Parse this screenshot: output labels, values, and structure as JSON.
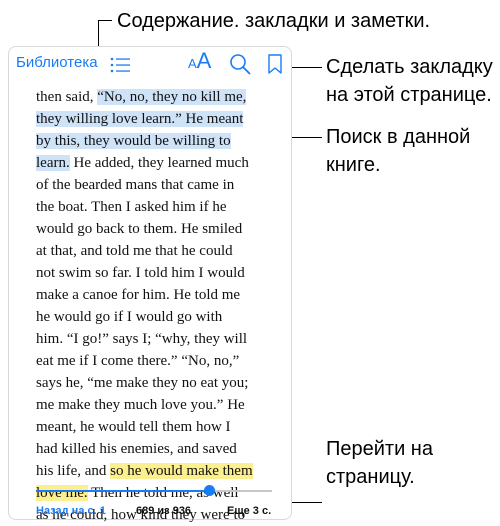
{
  "toolbar": {
    "library_label": "Библиотека",
    "font_small": "A",
    "font_large": "A",
    "toc_icon": "list-icon",
    "search_icon": "search-icon",
    "bookmark_icon": "bookmark-icon"
  },
  "callouts": {
    "toc": "Содержание. закладки и заметки.",
    "bookmark_line1": "Сделать закладку",
    "bookmark_line2": "на этой странице.",
    "search_line1": "Поиск в данной",
    "search_line2": "книге.",
    "goto_line1": "Перейти на",
    "goto_line2": "страницу."
  },
  "book": {
    "lines": [
      {
        "segments": [
          {
            "text": "then said, ",
            "hl": ""
          },
          {
            "text": "“No, no, they no kill me,",
            "hl": "blue"
          }
        ]
      },
      {
        "segments": [
          {
            "text": "they willing love learn.”  He meant",
            "hl": "blue"
          }
        ]
      },
      {
        "segments": [
          {
            "text": "by this, they would be willing to",
            "hl": "blue"
          }
        ]
      },
      {
        "segments": [
          {
            "text": "learn.",
            "hl": "blue"
          },
          {
            "text": "  He added, they learned much",
            "hl": ""
          }
        ]
      },
      {
        "segments": [
          {
            "text": "of the bearded mans that came in",
            "hl": ""
          }
        ]
      },
      {
        "segments": [
          {
            "text": "the boat.  Then I asked him if he",
            "hl": ""
          }
        ]
      },
      {
        "segments": [
          {
            "text": "would go back to them.  He smiled",
            "hl": ""
          }
        ]
      },
      {
        "segments": [
          {
            "text": "at that, and told me that he could",
            "hl": ""
          }
        ]
      },
      {
        "segments": [
          {
            "text": "not swim so far.  I told him I would",
            "hl": ""
          }
        ]
      },
      {
        "segments": [
          {
            "text": "make a canoe for him.  He told me",
            "hl": ""
          }
        ]
      },
      {
        "segments": [
          {
            "text": "he would go if I would go with",
            "hl": ""
          }
        ]
      },
      {
        "segments": [
          {
            "text": "him.  “I go!” says I; “why, they will",
            "hl": ""
          }
        ]
      },
      {
        "segments": [
          {
            "text": "eat me if I come there.”  “No, no,”",
            "hl": ""
          }
        ]
      },
      {
        "segments": [
          {
            "text": "says he, “me make they no eat you;",
            "hl": ""
          }
        ]
      },
      {
        "segments": [
          {
            "text": "me make they much love you.”  He",
            "hl": ""
          }
        ]
      },
      {
        "segments": [
          {
            "text": "meant, he would tell them how I",
            "hl": ""
          }
        ]
      },
      {
        "segments": [
          {
            "text": "had killed his enemies, and saved",
            "hl": ""
          }
        ]
      },
      {
        "segments": [
          {
            "text": "his life, and ",
            "hl": ""
          },
          {
            "text": "so he would make them",
            "hl": "yellow"
          }
        ]
      },
      {
        "segments": [
          {
            "text": "love me.",
            "hl": "yellow"
          },
          {
            "text": "  Then he told me, as well",
            "hl": ""
          }
        ]
      },
      {
        "segments": [
          {
            "text": "as he could, how kind they were to",
            "hl": ""
          }
        ]
      }
    ]
  },
  "footer": {
    "back_label": "Назад на с. 1",
    "page_count": "689 из 936",
    "pages_left": "Еще 3 с."
  },
  "progress": {
    "fraction": 0.736
  },
  "colors": {
    "accent": "#1a7cf5",
    "highlight_blue": "#cfe3f8",
    "highlight_yellow": "#fbef8f"
  }
}
